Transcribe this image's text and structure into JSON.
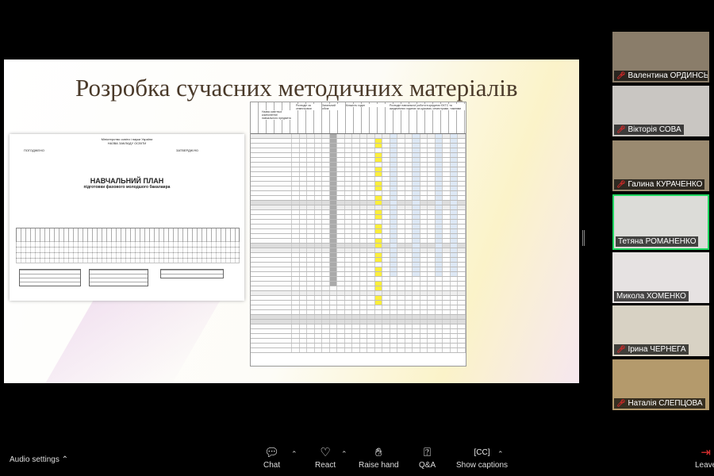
{
  "slide": {
    "title": "Розробка сучасних методичних матеріалів",
    "left_doc": {
      "ministry": "Міністерство освіти і науки України",
      "institution": "НАЗВА ЗАКЛАДУ ОСВІТИ",
      "agreed": "ПОГОДЖЕНО",
      "approved": "ЗАТВЕРДЖУЮ",
      "heading": "НАВЧАЛЬНИЙ ПЛАН",
      "subheading": "підготовки фахового молодшого бакалавра"
    },
    "right_doc": {
      "col1": "Назва освітньої компоненти/навчального предмета",
      "col2": "Розподіл за семестрами",
      "col3": "Загальний обсяг",
      "col4": "Кількість годин",
      "col5": "Розподіл навчальної роботи в кредитах ЄКТС та академічних годинах за курсами, семестрами, тижнями"
    }
  },
  "participants": [
    {
      "name": "Валентина ОРДИНСЬ...",
      "muted": true,
      "bg": "#8a7d6a"
    },
    {
      "name": "Вікторія СОВА",
      "muted": true,
      "bg": "#c9c6c2"
    },
    {
      "name": "Галина КУРАЧЕНКО",
      "muted": true,
      "bg": "#9a8a70"
    },
    {
      "name": "Тетяна РОМАНЕНКО",
      "muted": false,
      "active": true,
      "bg": "#dcdcd8"
    },
    {
      "name": "Микола ХОМЕНКО",
      "muted": false,
      "bg": "#e6e2e2"
    },
    {
      "name": "Ірина ЧЕРНЕГА",
      "muted": true,
      "bg": "#d8d2c4"
    },
    {
      "name": "Наталія СЛЕПЦОВА",
      "muted": true,
      "bg": "#b49a6c"
    }
  ],
  "toolbar": {
    "audio": "Audio settings",
    "chat": "Chat",
    "react": "React",
    "raise": "Raise hand",
    "qa": "Q&A",
    "captions": "Show captions",
    "leave": "Leave"
  }
}
